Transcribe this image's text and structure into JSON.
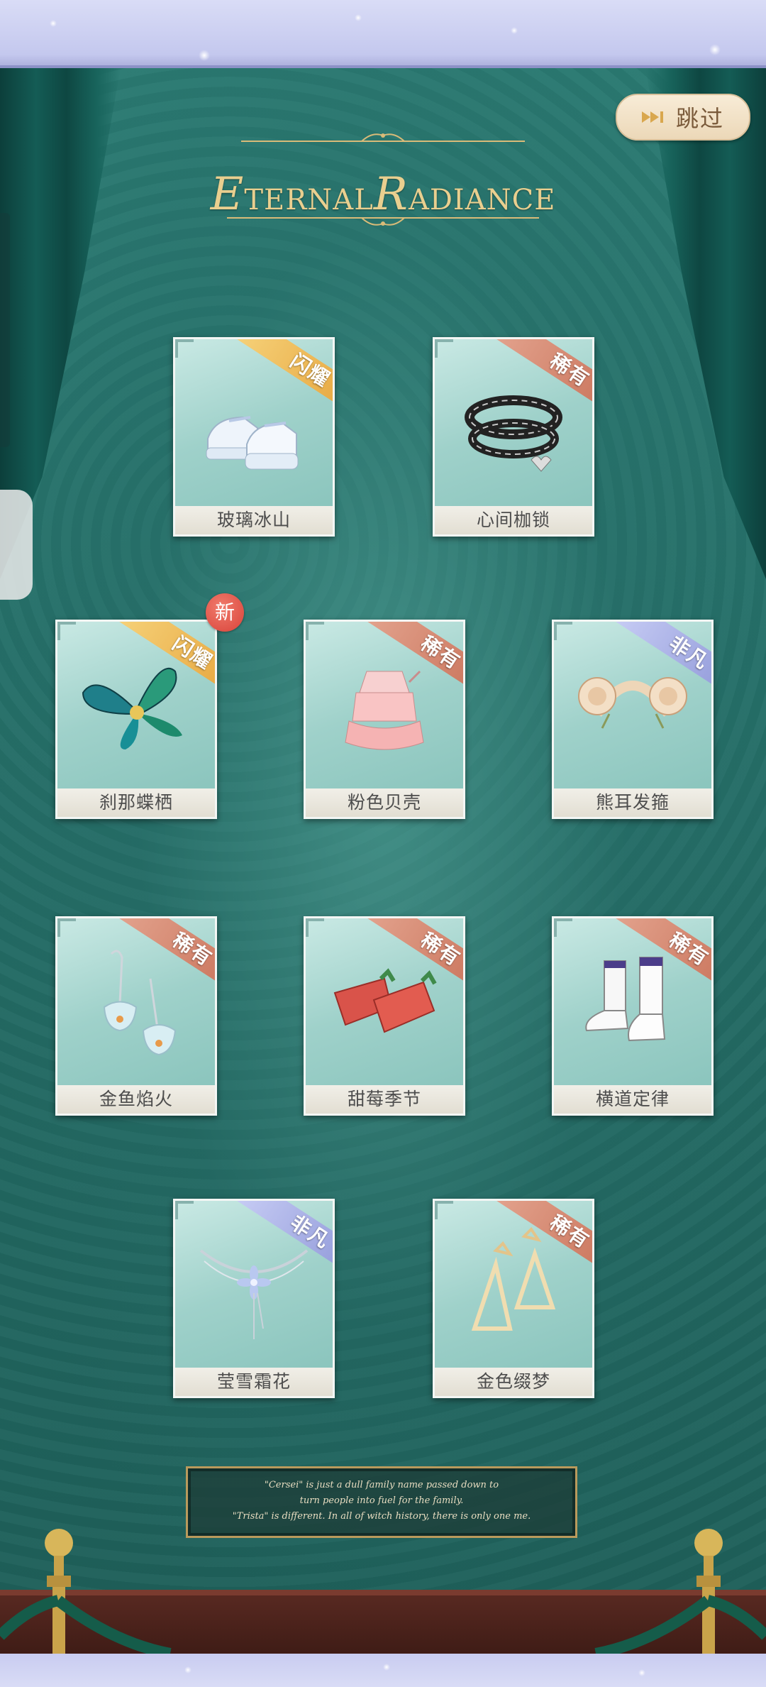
{
  "skip": {
    "label": "跳过",
    "icon": "fast-forward-icon"
  },
  "banner": {
    "first": "E",
    "rest1": "TERNAL",
    "second": "R",
    "rest2": "ADIANCE"
  },
  "rarity_colors": {
    "shine": "#e6a43c",
    "rare": "#c9735a",
    "fine": "#8f98d8"
  },
  "items": [
    {
      "name": "玻璃冰山",
      "rarity": "闪耀"
    },
    {
      "name": "心间枷锁",
      "rarity": "稀有"
    },
    {
      "name": "刹那蝶栖",
      "rarity": "闪耀",
      "badge": "新"
    },
    {
      "name": "粉色贝壳",
      "rarity": "稀有"
    },
    {
      "name": "熊耳发箍",
      "rarity": "非凡"
    },
    {
      "name": "金鱼焰火",
      "rarity": "稀有"
    },
    {
      "name": "甜莓季节",
      "rarity": "稀有"
    },
    {
      "name": "横道定律",
      "rarity": "稀有"
    },
    {
      "name": "莹雪霜花",
      "rarity": "非凡"
    },
    {
      "name": "金色缀梦",
      "rarity": "稀有"
    }
  ],
  "quote": {
    "line1": "\"Cersei\" is just a dull family name passed down to",
    "line2": "turn people into fuel for the family.",
    "line3": "\"Trista\" is different. In all of witch history, there is only one me."
  }
}
